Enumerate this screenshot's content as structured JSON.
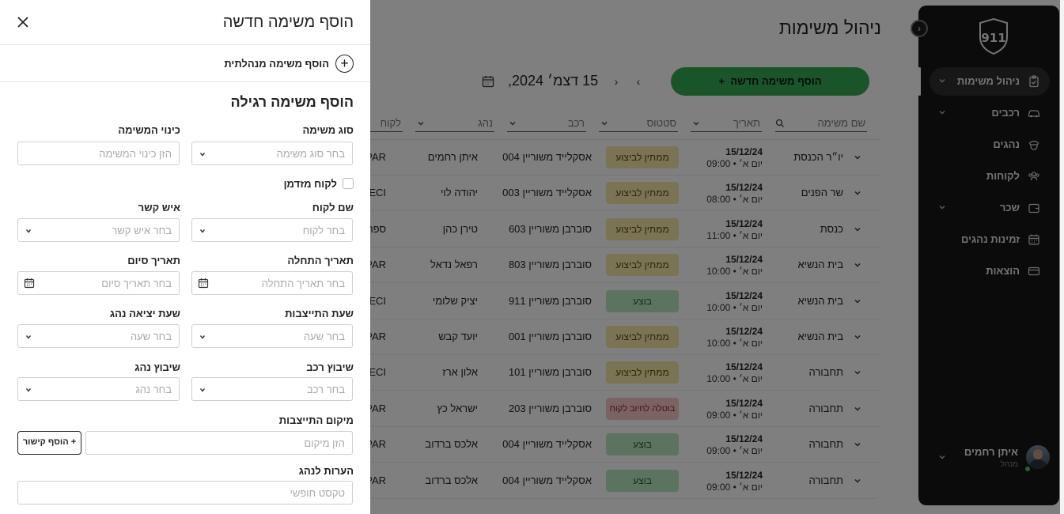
{
  "sidebar": {
    "logo_text": "911",
    "items": [
      {
        "label": "ניהול משימות",
        "icon": "clipboard-check-icon",
        "has_chevron": true
      },
      {
        "label": "רכבים",
        "icon": "car-icon",
        "has_chevron": true
      },
      {
        "label": "נהגים",
        "icon": "driver-icon",
        "has_chevron": false
      },
      {
        "label": "לקוחות",
        "icon": "users-icon",
        "has_chevron": false
      },
      {
        "label": "שכר",
        "icon": "wallet-icon",
        "has_chevron": true
      },
      {
        "label": "זמינות נהגים",
        "icon": "calendar-icon",
        "has_chevron": false
      },
      {
        "label": "הוצאות",
        "icon": "credit-card-icon",
        "has_chevron": false
      }
    ],
    "user": {
      "name": "איתן רחמים",
      "role": "מנהל"
    }
  },
  "main": {
    "title": "ניהול משימות",
    "add_button": "הוסף משימה חדשה",
    "date": "15 דצמ׳ 2024,",
    "columns": {
      "task_name": "שם משימה",
      "date": "תאריך",
      "status": "סטטוס",
      "vehicle": "רכב",
      "driver": "נהג",
      "client": "לקוח"
    },
    "rows": [
      {
        "name": "יו״ר הכנסת",
        "date": "15/12/24",
        "time": "יום א׳ • 09:00",
        "status": "ממתין לביצוע",
        "status_type": "pending",
        "vehicle": "אסקלייד משוריין 004",
        "driver": "איתן רחמים",
        "client": "PAR"
      },
      {
        "name": "שר הפנים",
        "date": "15/12/24",
        "time": "יום א׳ • 08:00",
        "status": "ממתין לביצוע",
        "status_type": "pending",
        "vehicle": "אסקלייד משוריין 003",
        "driver": "יהודה לוי",
        "client": "ECI"
      },
      {
        "name": "כנסת",
        "date": "15/12/24",
        "time": "יום א׳ • 11:00",
        "status": "ממתין לביצוע",
        "status_type": "pending",
        "vehicle": "סוברבן משוריין 603",
        "driver": "טירן כהן",
        "client": "ספר"
      },
      {
        "name": "בית הנשיא",
        "date": "15/12/24",
        "time": "יום א׳ • 10:00",
        "status": "ממתין לביצוע",
        "status_type": "pending",
        "vehicle": "סוברבן משוריין 803",
        "driver": "רפאל נדאל",
        "client": "PAR"
      },
      {
        "name": "בית הנשיא",
        "date": "15/12/24",
        "time": "יום א׳ • 10:00",
        "status": "בוצע",
        "status_type": "done",
        "vehicle": "סוברבן משוריין 911",
        "driver": "יציק שלומי",
        "client": "ECI"
      },
      {
        "name": "בית הנשיא",
        "date": "15/12/24",
        "time": "יום א׳ • 10:00",
        "status": "ממתין לביצוע",
        "status_type": "pending",
        "vehicle": "סוברבן משוריין 001",
        "driver": "יועד קבש",
        "client": "PAR"
      },
      {
        "name": "תחבורה",
        "date": "15/12/24",
        "time": "יום א׳ • 10:00",
        "status": "ממתין לביצוע",
        "status_type": "pending",
        "vehicle": "סוברבן משוריין 101",
        "driver": "אלון ארז",
        "client": "ECI"
      },
      {
        "name": "תחבורה",
        "date": "15/12/24",
        "time": "יום א׳ • 09:00",
        "status": "בוטלה לחיוב לקוח",
        "status_type": "cancel",
        "vehicle": "סוברבן משוריין 203",
        "driver": "ישראל כץ",
        "client": "PAR"
      },
      {
        "name": "תחבורה",
        "date": "15/12/24",
        "time": "יום א׳ • 09:00",
        "status": "בוצע",
        "status_type": "done",
        "vehicle": "אסקלייד משוריין 004",
        "driver": "אלכס ברדוב",
        "client": "PAR"
      },
      {
        "name": "תחבורה",
        "date": "15/12/24",
        "time": "יום א׳ • 09:00",
        "status": "בוצע",
        "status_type": "done",
        "vehicle": "אסקלייד משוריין 004",
        "driver": "אלכס ברדוב",
        "client": "PAR"
      }
    ]
  },
  "panel": {
    "title": "הוסף משימה חדשה",
    "management_task": "הוסף משימה מנהלתית",
    "subtitle": "הוסף משימה רגילה",
    "fields": {
      "task_type": {
        "label": "סוג משימה",
        "placeholder": "בחר סוג משימה"
      },
      "task_alias": {
        "label": "כינוי המשימה",
        "placeholder": "הזן כינוי המשימה"
      },
      "occasional_client": {
        "label": "לקוח מזדמן"
      },
      "client_name": {
        "label": "שם לקוח",
        "placeholder": "בחר לקוח"
      },
      "contact": {
        "label": "איש קשר",
        "placeholder": "בחר איש קשר"
      },
      "start_date": {
        "label": "תאריך התחלה",
        "placeholder": "בחר תאריך התחלה"
      },
      "end_date": {
        "label": "תאריך סיום",
        "placeholder": "בחר תאריך סיום"
      },
      "report_time": {
        "label": "שעת התייצבות",
        "placeholder": "בחר שעה"
      },
      "driver_departure": {
        "label": "שעת יציאה נהג",
        "placeholder": "בחר שעה"
      },
      "vehicle_assign": {
        "label": "שיבוץ רכב",
        "placeholder": "בחר רכב"
      },
      "driver_assign": {
        "label": "שיבוץ נהג",
        "placeholder": "בחר נהג"
      },
      "report_location": {
        "label": "מיקום התייצבות",
        "placeholder": "הזן מיקום"
      },
      "driver_notes": {
        "label": "הערות לנהג",
        "placeholder": "טקסט חופשי"
      }
    },
    "add_link_button": "+ הוסף קישור"
  },
  "colors": {
    "sidebar_bg": "#161616",
    "accent_green": "#34a853",
    "status_pending": "#f5e7a8",
    "status_done": "#b8e7c0",
    "status_cancel": "#f6c7c7"
  }
}
